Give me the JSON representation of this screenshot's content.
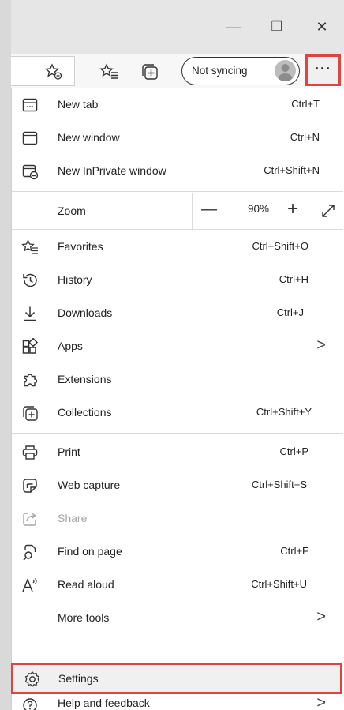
{
  "window": {
    "minimize": "—",
    "restore": "❐",
    "close": "✕"
  },
  "toolbar": {
    "sync_label": "Not syncing",
    "more_label": "···"
  },
  "menu": {
    "new_tab": {
      "label": "New tab",
      "shortcut": "Ctrl+T"
    },
    "new_window": {
      "label": "New window",
      "shortcut": "Ctrl+N"
    },
    "new_inprivate": {
      "label": "New InPrivate window",
      "shortcut": "Ctrl+Shift+N"
    },
    "zoom": {
      "label": "Zoom",
      "minus": "—",
      "value": "90%",
      "plus": "+"
    },
    "favorites": {
      "label": "Favorites",
      "shortcut": "Ctrl+Shift+O"
    },
    "history": {
      "label": "History",
      "shortcut": "Ctrl+H"
    },
    "downloads": {
      "label": "Downloads",
      "shortcut": "Ctrl+J"
    },
    "apps": {
      "label": "Apps",
      "arrow": ">"
    },
    "extensions": {
      "label": "Extensions"
    },
    "collections": {
      "label": "Collections",
      "shortcut": "Ctrl+Shift+Y"
    },
    "print": {
      "label": "Print",
      "shortcut": "Ctrl+P"
    },
    "web_capture": {
      "label": "Web capture",
      "shortcut": "Ctrl+Shift+S"
    },
    "share": {
      "label": "Share"
    },
    "find": {
      "label": "Find on page",
      "shortcut": "Ctrl+F"
    },
    "read_aloud": {
      "label": "Read aloud",
      "shortcut": "Ctrl+Shift+U"
    },
    "more_tools": {
      "label": "More tools",
      "arrow": ">"
    },
    "settings": {
      "label": "Settings"
    },
    "help": {
      "label": "Help and feedback",
      "arrow": ">"
    }
  },
  "colors": {
    "highlight": "#e0443f",
    "titlebar": "#e6e6e6",
    "disabled": "#a6a6a6"
  }
}
